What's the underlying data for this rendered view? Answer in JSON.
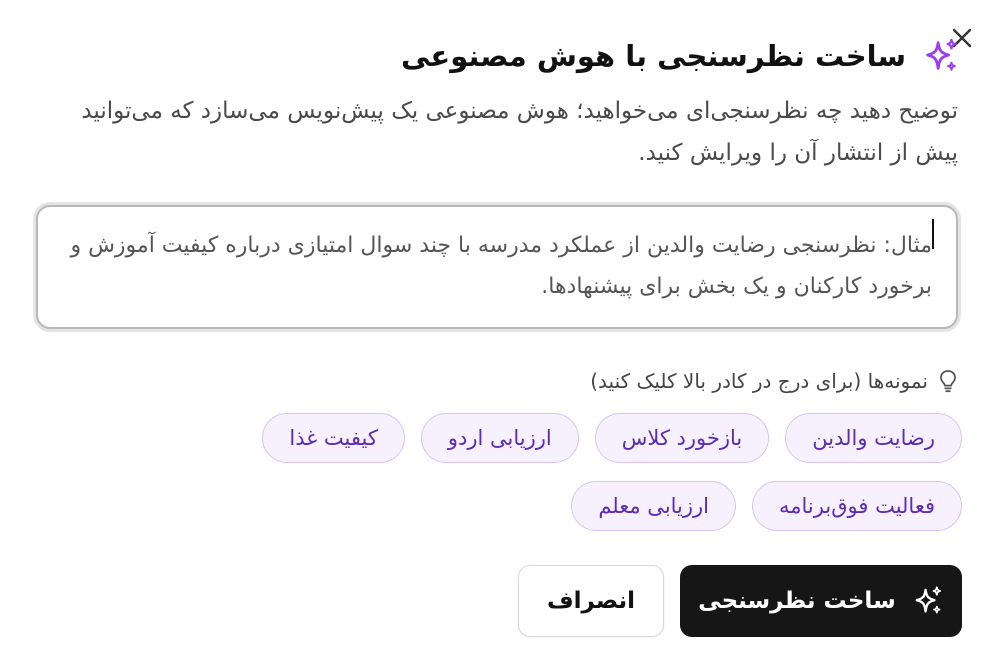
{
  "dialog": {
    "title": "ساخت نظرسنجی با هوش مصنوعی",
    "description": "توضیح دهید چه نظرسنجی‌ای می‌خواهید؛ هوش مصنوعی یک پیش‌نویس می‌سازد که می‌توانید پیش از انتشار آن را ویرایش کنید.",
    "accent_color": "#9b3df2"
  },
  "prompt": {
    "value": "",
    "placeholder": "مثال: نظرسنجی رضایت والدین از عملکرد مدرسه با چند سوال امتیازی درباره کیفیت آموزش و برخورد کارکنان و یک بخش برای پیشنهادها."
  },
  "examples": {
    "label": "نمونه‌ها (برای درج در کادر بالا کلیک کنید)",
    "chips": [
      "رضایت والدین",
      "بازخورد کلاس",
      "ارزیابی اردو",
      "کیفیت غذا",
      "فعالیت فوق‌برنامه",
      "ارزیابی معلم"
    ]
  },
  "actions": {
    "generate_label": "ساخت نظرسنجی",
    "cancel_label": "انصراف"
  },
  "icons": {
    "close": "close-icon",
    "title": "sparkles-icon",
    "hint": "lightbulb-icon",
    "generate": "sparkles-icon"
  }
}
